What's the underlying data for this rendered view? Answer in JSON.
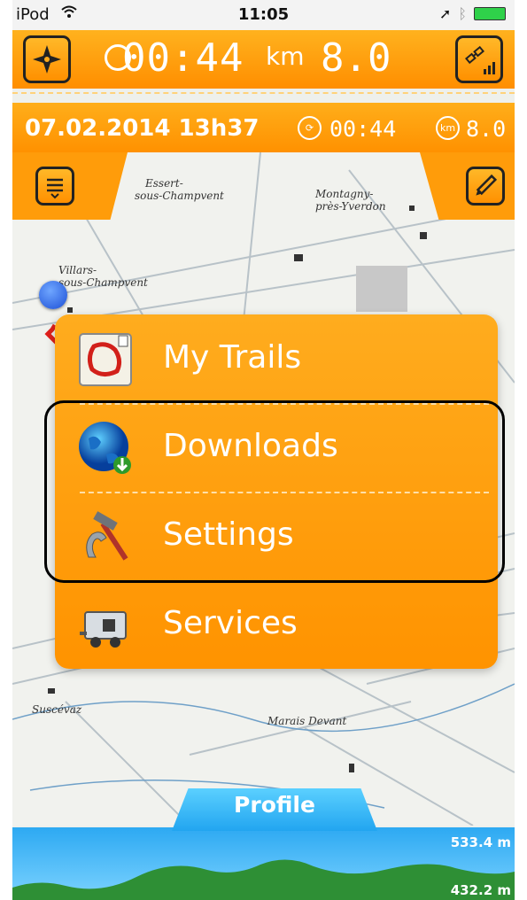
{
  "status_bar": {
    "carrier": "iPod",
    "time": "11:05"
  },
  "top_bar": {
    "elapsed": "00:44",
    "distance_unit": "km",
    "distance": "8.0"
  },
  "info_bar": {
    "datetime": "07.02.2014 13h37",
    "elapsed": "00:44",
    "distance": "8.0",
    "distance_unit": "km"
  },
  "map": {
    "labels": [
      "Montagny-",
      "près-Yverdon",
      "Essert-",
      "sous-Champvent",
      "Villars-",
      "sous-Champvent",
      "Suscévaz",
      "Marais Devant"
    ]
  },
  "menu": {
    "items": [
      {
        "label": "My Trails",
        "icon": "trail-map-icon"
      },
      {
        "label": "Downloads",
        "icon": "globe-download-icon"
      },
      {
        "label": "Settings",
        "icon": "tools-icon"
      },
      {
        "label": "Services",
        "icon": "trailer-icon"
      }
    ]
  },
  "profile": {
    "tab_label": "Profile",
    "max_elevation": "533.4 m",
    "min_elevation": "432.2 m"
  },
  "colors": {
    "accent_orange": "#ff9a00",
    "profile_blue": "#2da9f2",
    "track_red": "#e0201c"
  }
}
